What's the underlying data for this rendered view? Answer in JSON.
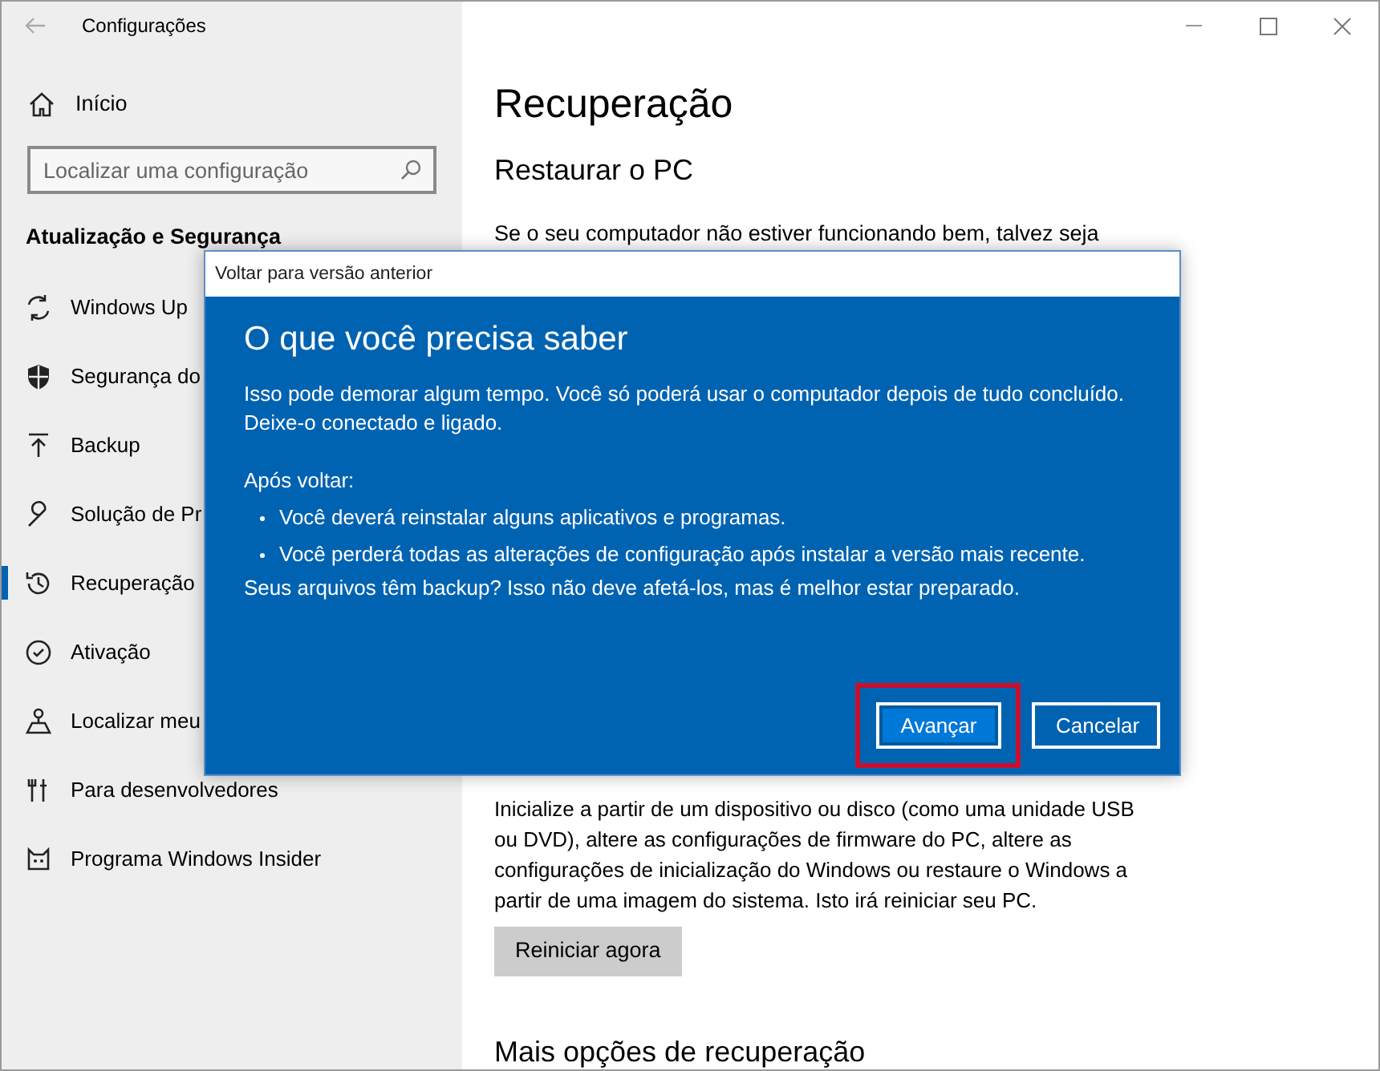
{
  "window": {
    "title": "Configurações"
  },
  "sidebar": {
    "home": "Início",
    "search": {
      "placeholder": "Localizar uma configuração"
    },
    "section": "Atualização e Segurança",
    "items": [
      {
        "label": "Windows Up",
        "selected": false
      },
      {
        "label": "Segurança do",
        "selected": false
      },
      {
        "label": "Backup",
        "selected": false
      },
      {
        "label": "Solução de Pr",
        "selected": false
      },
      {
        "label": "Recuperação",
        "selected": true
      },
      {
        "label": "Ativação",
        "selected": false
      },
      {
        "label": "Localizar meu",
        "selected": false
      },
      {
        "label": "Para desenvolvedores",
        "selected": false
      },
      {
        "label": "Programa Windows Insider",
        "selected": false
      }
    ]
  },
  "main": {
    "title": "Recuperação",
    "section": "Restaurar o PC",
    "intro": "Se o seu computador não estiver funcionando bem, talvez seja",
    "paragraph": "Inicialize a partir de um dispositivo ou disco (como uma unidade USB ou DVD), altere as configurações de firmware do PC, altere as configurações de inicialização do Windows ou restaure o Windows a partir de uma imagem do sistema. Isto irá reiniciar seu PC.",
    "button": "Reiniciar agora",
    "section_2": "Mais opções de recuperação"
  },
  "dialog": {
    "title": "Voltar para versão anterior",
    "heading": "O que você precisa saber",
    "intro": "Isso pode demorar algum tempo. Você só poderá usar o computador depois de tudo concluído. Deixe-o conectado e ligado.",
    "list_heading": "Após voltar:",
    "bullets": [
      "Você deverá reinstalar alguns aplicativos e programas.",
      "Você perderá todas as alterações de configuração após instalar a versão mais recente."
    ],
    "closing": "Seus arquivos têm backup? Isso não deve afetá-los, mas é melhor estar preparado.",
    "buttons": [
      {
        "label": "Avançar",
        "focused": true,
        "highlighted": true
      },
      {
        "label": "Cancelar",
        "focused": false,
        "highlighted": false
      }
    ]
  }
}
